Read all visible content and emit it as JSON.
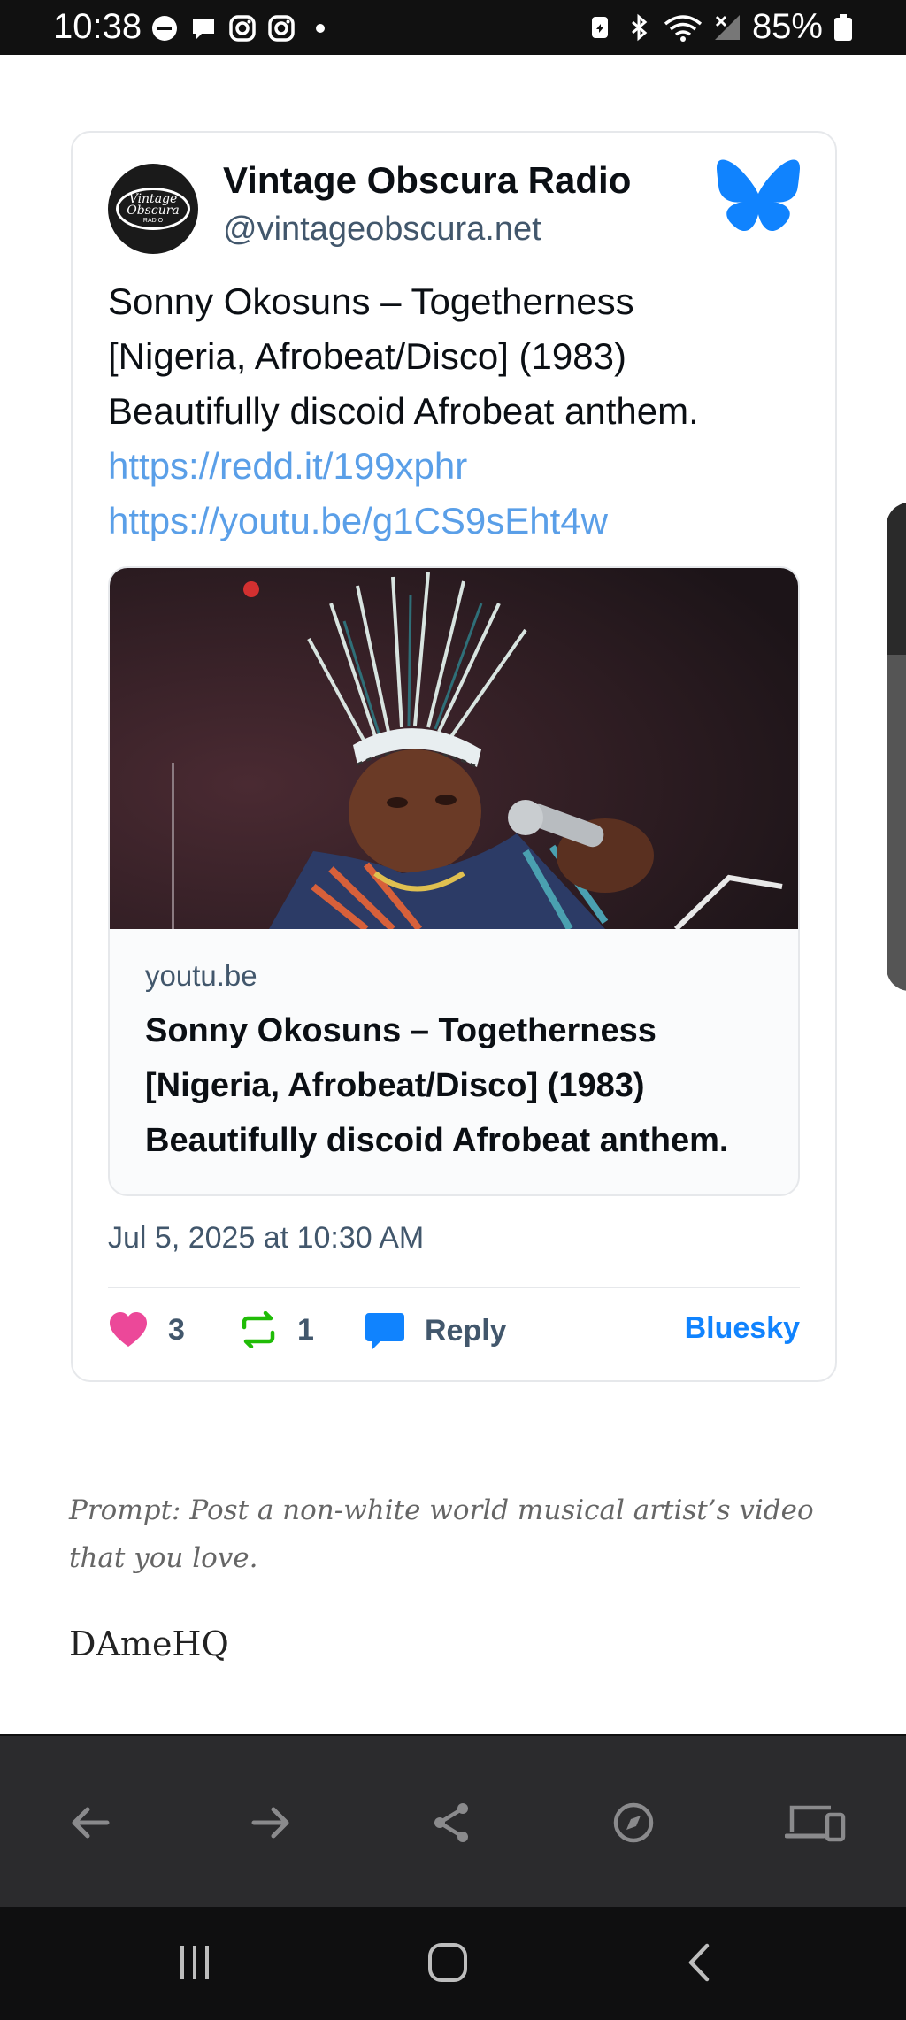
{
  "status_bar": {
    "time": "10:38",
    "battery": "85%",
    "left_icons": [
      "minus-circle-icon",
      "chat-bubble-icon",
      "instagram-icon",
      "instagram-icon",
      "dot-icon"
    ],
    "right_icons": [
      "nfc-icon",
      "bluetooth-icon",
      "wifi-icon",
      "signal-icon",
      "battery-icon"
    ]
  },
  "embed": {
    "author_name": "Vintage Obscura Radio",
    "author_handle": "@vintageobscura.net",
    "avatar_text_1": "Vintage",
    "avatar_text_2": "Obscura",
    "avatar_text_3": "RADIO",
    "post_text_line1": "Sonny Okosuns – Togetherness",
    "post_text_line2": "[Nigeria, Afrobeat/Disco] (1983)",
    "post_text_line3": "Beautifully discoid Afrobeat anthem.",
    "link1": "https://redd.it/199xphr",
    "link2": "https://youtu.be/g1CS9sEht4w",
    "link_card": {
      "domain": "youtu.be",
      "title": "Sonny Okosuns – Togetherness [Nigeria, Afrobeat/Disco] (1983) Beautifully discoid Afrobeat anthem."
    },
    "date": "Jul 5, 2025 at 10:30 AM",
    "likes": "3",
    "reposts": "1",
    "reply_label": "Reply",
    "bluesky_label": "Bluesky",
    "brand_color": "#1083fe",
    "like_color": "#ec4899",
    "repost_color": "#20bc07"
  },
  "post": {
    "prompt": "Prompt: Post a non-white world musical artist’s video that you love.",
    "signature": "DAmeHQ"
  },
  "toolbar": {
    "buttons": [
      "back-arrow-icon",
      "forward-arrow-icon",
      "share-icon",
      "compass-icon",
      "devices-icon"
    ]
  },
  "navbar": {
    "buttons": [
      "recents-icon",
      "home-icon",
      "back-icon"
    ]
  }
}
